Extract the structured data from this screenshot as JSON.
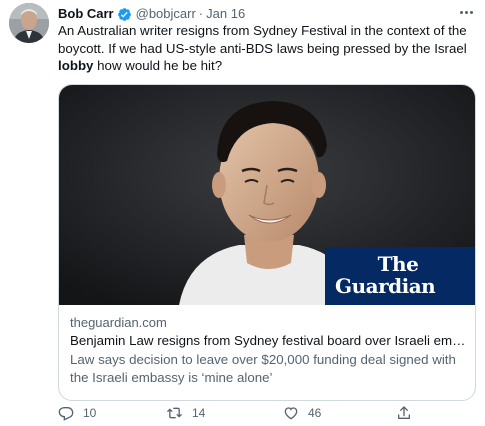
{
  "tweet": {
    "author_name": "Bob Carr",
    "author_handle": "@bobjcarr",
    "separator": "·",
    "date": "Jan 16",
    "text_before_bold": "An Australian writer resigns from Sydney Festival in the context of the boycott. If we had US-style anti-BDS laws being pressed by the Israel ",
    "text_bold": "lobby",
    "text_after_bold": " how would he be hit?"
  },
  "card": {
    "publisher_logo_line1": "The",
    "publisher_logo_line2": "Guardian",
    "domain": "theguardian.com",
    "title": "Benjamin Law resigns from Sydney festival board over Israeli embassy funding deal",
    "description": "Law says decision to leave over $20,000 funding deal signed with the Israeli embassy is ‘mine alone’"
  },
  "actions": {
    "reply_count": "10",
    "retweet_count": "14",
    "like_count": "46"
  },
  "icons": [
    "verified-badge-icon",
    "more-options-icon",
    "reply-icon",
    "retweet-icon",
    "like-icon",
    "share-icon"
  ],
  "colors": {
    "verified": "#1d9bf0",
    "secondary_text": "#536471",
    "guardian_blue": "#052962",
    "card_border": "#cfd9de"
  }
}
